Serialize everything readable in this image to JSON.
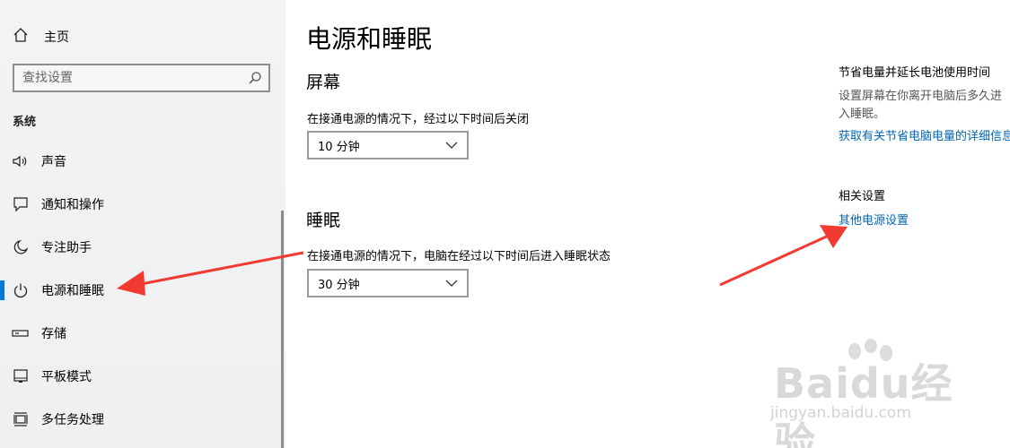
{
  "sidebar": {
    "home_label": "主页",
    "search_placeholder": "查找设置",
    "section_title": "系统",
    "items": [
      {
        "label": "声音",
        "icon": "speaker-icon"
      },
      {
        "label": "通知和操作",
        "icon": "message-icon"
      },
      {
        "label": "专注助手",
        "icon": "moon-icon"
      },
      {
        "label": "电源和睡眠",
        "icon": "power-icon",
        "selected": true
      },
      {
        "label": "存储",
        "icon": "storage-icon"
      },
      {
        "label": "平板模式",
        "icon": "tablet-icon"
      },
      {
        "label": "多任务处理",
        "icon": "multitask-icon"
      }
    ]
  },
  "main": {
    "title": "电源和睡眠",
    "screen": {
      "heading": "屏幕",
      "description": "在接通电源的情况下，经过以下时间后关闭",
      "value": "10 分钟"
    },
    "sleep": {
      "heading": "睡眠",
      "description": "在接通电源的情况下，电脑在经过以下时间后进入睡眠状态",
      "value": "30 分钟"
    }
  },
  "right_panel": {
    "save_power_title": "节省电量并延长电池使用时间",
    "save_power_desc": "设置屏幕在你离开电脑后多久进入睡眠。",
    "save_power_link": "获取有关节省电脑电量的详细信息",
    "related_title": "相关设置",
    "related_link": "其他电源设置"
  },
  "watermark": {
    "logo": "Baidu经验",
    "sub": "jingyan.baidu.com"
  },
  "colors": {
    "accent": "#0078d7",
    "link": "#0066b4",
    "arrow": "#f03a32",
    "sidebar_bg": "#f0f2f3"
  }
}
